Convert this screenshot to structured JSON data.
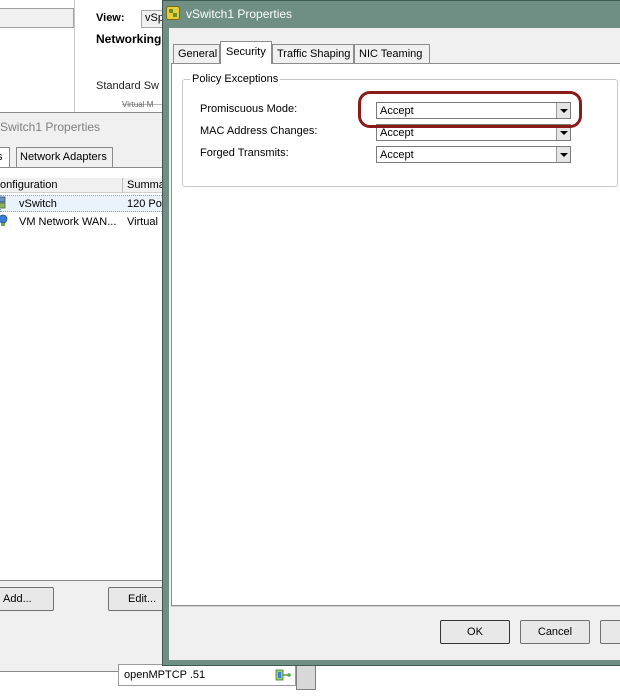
{
  "background": {
    "view_label": "View:",
    "view_value": "vSp",
    "section_title": "Networking",
    "standard_switch": "Standard Sw",
    "virtual_machine": "Virtual M",
    "props_window": {
      "title": "Switch1 Properties",
      "tab_partial": "s",
      "tab_network_adapters": "Network Adapters",
      "col_configuration": "onfiguration",
      "col_summary": "Summa",
      "rows": [
        {
          "name": "vSwitch",
          "summary": "120 Po"
        },
        {
          "name": "VM Network WAN...",
          "summary": "Virtual"
        }
      ],
      "add_button": "Add...",
      "edit_button": "Edit..."
    },
    "vm_label": "openMPTCP .51"
  },
  "dialog": {
    "title": "vSwitch1 Properties",
    "tabs": [
      "General",
      "Security",
      "Traffic Shaping",
      "NIC Teaming"
    ],
    "active_tab": "Security",
    "group_title": "Policy Exceptions",
    "fields": [
      {
        "label": "Promiscuous Mode:",
        "value": "Accept"
      },
      {
        "label": "MAC Address Changes:",
        "value": "Accept"
      },
      {
        "label": "Forged Transmits:",
        "value": "Accept"
      }
    ],
    "ok_button": "OK",
    "cancel_button": "Cancel"
  },
  "colors": {
    "title_bar": "#6f8f84",
    "highlight": "#8b1a1a",
    "selection": "#eaf2fb"
  }
}
